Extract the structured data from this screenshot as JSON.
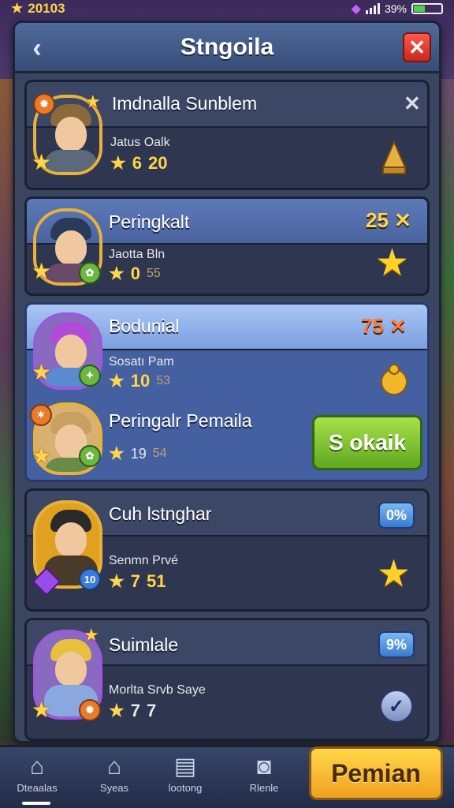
{
  "status": {
    "coins": "20103",
    "battery": "39%",
    "battery_level": 0.39
  },
  "header": {
    "title": "Stngoila"
  },
  "cards": [
    {
      "name": "Imdnalla Sunblem",
      "sub": "Jatus Oalk",
      "stat1": "6",
      "stat2": "20"
    },
    {
      "name": "Peringkalt",
      "sub": "Jaotta Bln",
      "stat1": "0",
      "stat2": "55",
      "count": "25 ✕"
    },
    {
      "name": "Bodunial",
      "sub": "Sosatı Pam",
      "stat1": "10",
      "stat2": "53",
      "count": "75 ✕"
    },
    {
      "name": "Peringalr Pemaila",
      "stat1": "19",
      "stat2": "54",
      "button": "S okaik"
    },
    {
      "name": "Cuh lstnghar",
      "sub": "Senmn Prvé",
      "stat1": "7",
      "stat2": "51",
      "pill": "0%",
      "badge": "10"
    },
    {
      "name": "Suimlale",
      "sub": "Morlta Srvb Saye",
      "stat1": "7",
      "stat2": "7",
      "pill": "9%"
    }
  ],
  "nav": {
    "items": [
      {
        "label": "Dteaalas",
        "icon": "home-icon"
      },
      {
        "label": "Syeas",
        "icon": "house-icon"
      },
      {
        "label": "lootong",
        "icon": "scroll-icon"
      },
      {
        "label": "Rlenle",
        "icon": "camera-icon"
      }
    ],
    "primary": "Pemian"
  }
}
